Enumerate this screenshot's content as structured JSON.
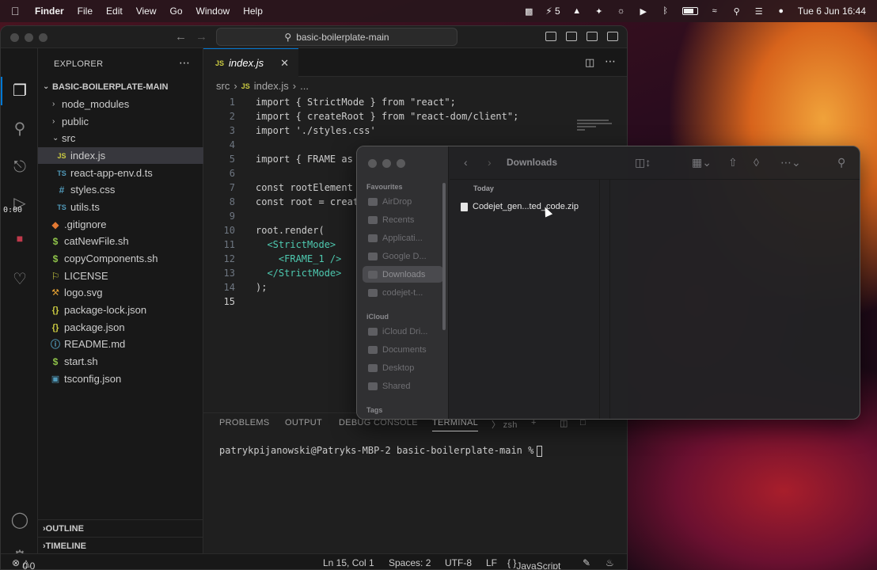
{
  "menubar": {
    "app_name": "Finder",
    "items": [
      "File",
      "Edit",
      "View",
      "Go",
      "Window",
      "Help"
    ],
    "badge_count": "5",
    "datetime": "Tue 6 Jun  16:44"
  },
  "vscode": {
    "search_text": "basic-boilerplate-main",
    "timer": "0:00",
    "explorer": {
      "title": "EXPLORER",
      "root": "BASIC-BOILERPLATE-MAIN",
      "items": [
        {
          "label": "node_modules",
          "icon": "chevron-right-icon"
        },
        {
          "label": "public",
          "icon": "chevron-right-icon"
        },
        {
          "label": "src",
          "icon": "chevron-down-icon"
        },
        {
          "label": "index.js",
          "icon": "js-file-icon",
          "badge": "JS"
        },
        {
          "label": "react-app-env.d.ts",
          "icon": "ts-file-icon",
          "badge": "TS"
        },
        {
          "label": "styles.css",
          "icon": "css-file-icon",
          "badge": "#"
        },
        {
          "label": "utils.ts",
          "icon": "ts-file-icon",
          "badge": "TS"
        },
        {
          "label": ".gitignore",
          "icon": "git-file-icon"
        },
        {
          "label": "catNewFile.sh",
          "icon": "shell-file-icon",
          "badge": "$"
        },
        {
          "label": "copyComponents.sh",
          "icon": "shell-file-icon",
          "badge": "$"
        },
        {
          "label": "LICENSE",
          "icon": "license-file-icon"
        },
        {
          "label": "logo.svg",
          "icon": "svg-file-icon"
        },
        {
          "label": "package-lock.json",
          "icon": "json-file-icon",
          "badge": "{}"
        },
        {
          "label": "package.json",
          "icon": "json-file-icon",
          "badge": "{}"
        },
        {
          "label": "README.md",
          "icon": "info-file-icon"
        },
        {
          "label": "start.sh",
          "icon": "shell-file-icon",
          "badge": "$"
        },
        {
          "label": "tsconfig.json",
          "icon": "ts-config-icon"
        }
      ],
      "outline": "OUTLINE",
      "timeline": "TIMELINE"
    },
    "tab": {
      "badge": "JS",
      "label": "index.js"
    },
    "breadcrumb": {
      "folder": "src",
      "badge": "JS",
      "file": "index.js",
      "more": "..."
    },
    "code": [
      "import { StrictMode } from \"react\";",
      "import { createRoot } from \"react-dom/client\";",
      "import './styles.css'",
      "",
      "import { FRAME as",
      "",
      "const rootElement",
      "const root = creat",
      "",
      "root.render(",
      "  <StrictMode>",
      "    <FRAME_1 />",
      "  </StrictMode>",
      ");",
      ""
    ],
    "panel_tabs": [
      "PROBLEMS",
      "OUTPUT",
      "DEBUG CONSOLE",
      "TERMINAL"
    ],
    "terminal_shell": "zsh",
    "terminal_prompt": "patrykpijanowski@Patryks-MBP-2 basic-boilerplate-main %",
    "status": {
      "errors": "0",
      "warnings": "0",
      "position": "Ln 15, Col 1",
      "spaces": "Spaces: 2",
      "encoding": "UTF-8",
      "eol": "LF",
      "language": "JavaScript"
    }
  },
  "finder": {
    "title": "Downloads",
    "favourites_label": "Favourites",
    "favourites": [
      "AirDrop",
      "Recents",
      "Applicati...",
      "Google D...",
      "Downloads",
      "codejet-t..."
    ],
    "icloud_label": "iCloud",
    "icloud": [
      "iCloud Dri...",
      "Documents",
      "Desktop",
      "Shared"
    ],
    "tags_label": "Tags",
    "group_label": "Today",
    "file": "Codejet_gen...ted_code.zip"
  }
}
